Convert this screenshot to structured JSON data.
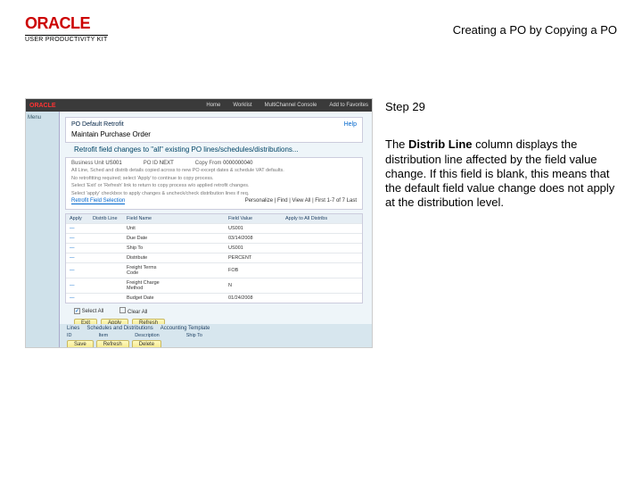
{
  "header": {
    "brand": "ORACLE",
    "product_kit": "USER PRODUCTIVITY KIT",
    "doc_title": "Creating a PO by Copying a PO"
  },
  "step": {
    "label": "Step 29",
    "desc_prefix": "The ",
    "desc_bold": "Distrib Line",
    "desc_rest": " column displays the distribution line affected by the field value change. If this field is blank, this means that the default field value change does not apply at the distribution level."
  },
  "screenshot": {
    "topbar": {
      "brand": "ORACLE",
      "nav": [
        "Home",
        "Worklist",
        "MultiChannel Console",
        "Add to Favorites"
      ]
    },
    "leftcol": [
      "Menu",
      "",
      "",
      "",
      ""
    ],
    "panel": {
      "breadcrumb": "PO Default Retrofit",
      "help": "Help",
      "title": "Maintain Purchase Order"
    },
    "retro_banner": "Retrofit field changes to \"all\" existing PO lines/schedules/distributions...",
    "info": {
      "rows": [
        [
          "Business Unit",
          "US001",
          "PO ID",
          "NEXT",
          "Copy From",
          "0000000040"
        ]
      ],
      "notes": [
        "All Line, Sched and distrib details copied across to new PO except dates & schedule VAT defaults.",
        "No retrofitting required; select 'Apply' to continue to copy process.",
        "Select 'Exit' or 'Refresh' link to return to copy process w/o applied retrofit changes.",
        "Select 'apply' checkbox to apply changes & uncheck/check distribution lines if req."
      ],
      "link": "Retrofit Field Selection",
      "pager": "Personalize | Find | View All | First 1-7 of 7 Last"
    },
    "table": {
      "headers": [
        "Apply",
        "Distrib Line",
        "Field Name",
        "",
        "Field Value",
        "Apply to All Distribs"
      ],
      "rows": [
        [
          "—",
          "",
          "Unit",
          "",
          "US001",
          ""
        ],
        [
          "—",
          "",
          "Due Date",
          "",
          "03/14/2008",
          ""
        ],
        [
          "—",
          "",
          "Ship To",
          "",
          "US001",
          ""
        ],
        [
          "—",
          "",
          "Distribute",
          "",
          "PERCENT",
          ""
        ],
        [
          "—",
          "",
          "Freight Terms Code",
          "",
          "FOB",
          ""
        ],
        [
          "—",
          "",
          "Freight Charge Method",
          "",
          "N",
          ""
        ],
        [
          "—",
          "",
          "Budget Date",
          "",
          "01/24/2008",
          ""
        ]
      ]
    },
    "checks": [
      {
        "checked": true,
        "label": "Select All"
      },
      {
        "checked": false,
        "label": "Clear All"
      }
    ],
    "buttons": [
      "Exit",
      "Apply",
      "Refresh"
    ],
    "footer": {
      "tabs_line1": [
        "Lines",
        "Schedules and Distributions",
        "Accounting Template"
      ],
      "fields": [
        "ID",
        "Item",
        "Description",
        "Ship To"
      ],
      "buttons": [
        "Save",
        "Refresh",
        "Delete"
      ]
    }
  }
}
